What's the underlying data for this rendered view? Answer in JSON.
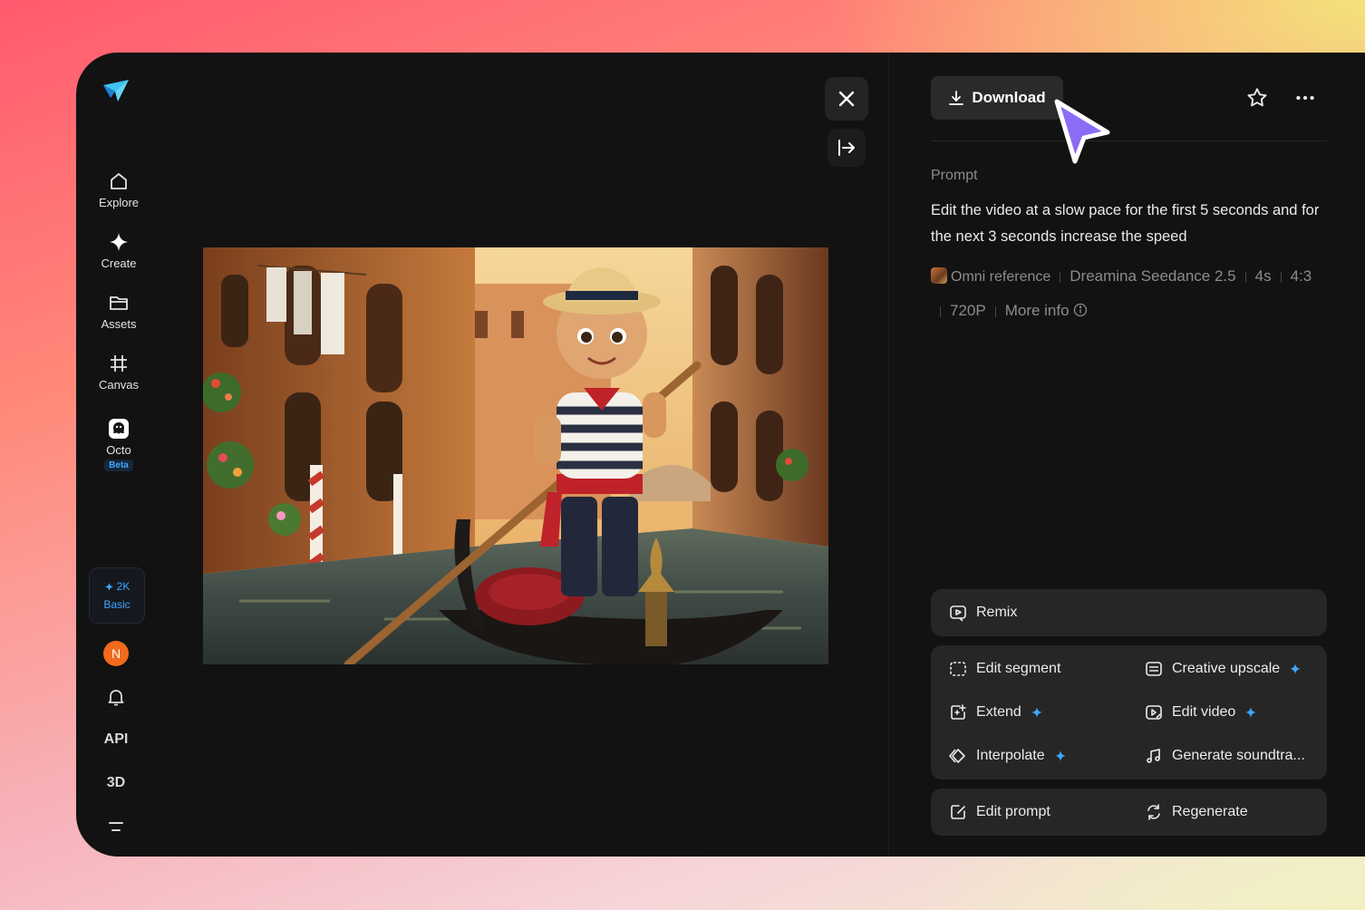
{
  "sidebar": {
    "nav": [
      {
        "label": "Explore",
        "icon": "home-icon"
      },
      {
        "label": "Create",
        "icon": "sparkle-icon"
      },
      {
        "label": "Assets",
        "icon": "folder-icon"
      },
      {
        "label": "Canvas",
        "icon": "canvas-icon"
      },
      {
        "label": "Octo",
        "icon": "octo-icon",
        "badge": "Beta"
      }
    ],
    "plan": {
      "credits": "2K",
      "tier": "Basic"
    },
    "avatar_initial": "N",
    "api_label": "API",
    "threed_label": "3D"
  },
  "viewer": {
    "image_alt": "Animated boy in straw hat and striped shirt rowing a gondola in a Venice canal"
  },
  "panel": {
    "download_label": "Download",
    "prompt_label": "Prompt",
    "prompt_text": "Edit the video at a slow pace for the first 5 seconds and for the next 3 seconds increase the speed",
    "meta": {
      "reference": "Omni reference",
      "model": "Dreamina Seedance 2.5",
      "duration": "4s",
      "ratio": "4:3",
      "resolution": "720P",
      "more_info": "More info"
    },
    "actions": {
      "remix": "Remix",
      "edit_segment": "Edit segment",
      "creative_upscale": "Creative upscale",
      "extend": "Extend",
      "edit_video": "Edit video",
      "interpolate": "Interpolate",
      "generate_soundtrack": "Generate soundtra...",
      "edit_prompt": "Edit prompt",
      "regenerate": "Regenerate"
    }
  },
  "colors": {
    "accent": "#3ea6ff",
    "avatar": "#f26a1b",
    "cursor": "#8b6cf6"
  }
}
